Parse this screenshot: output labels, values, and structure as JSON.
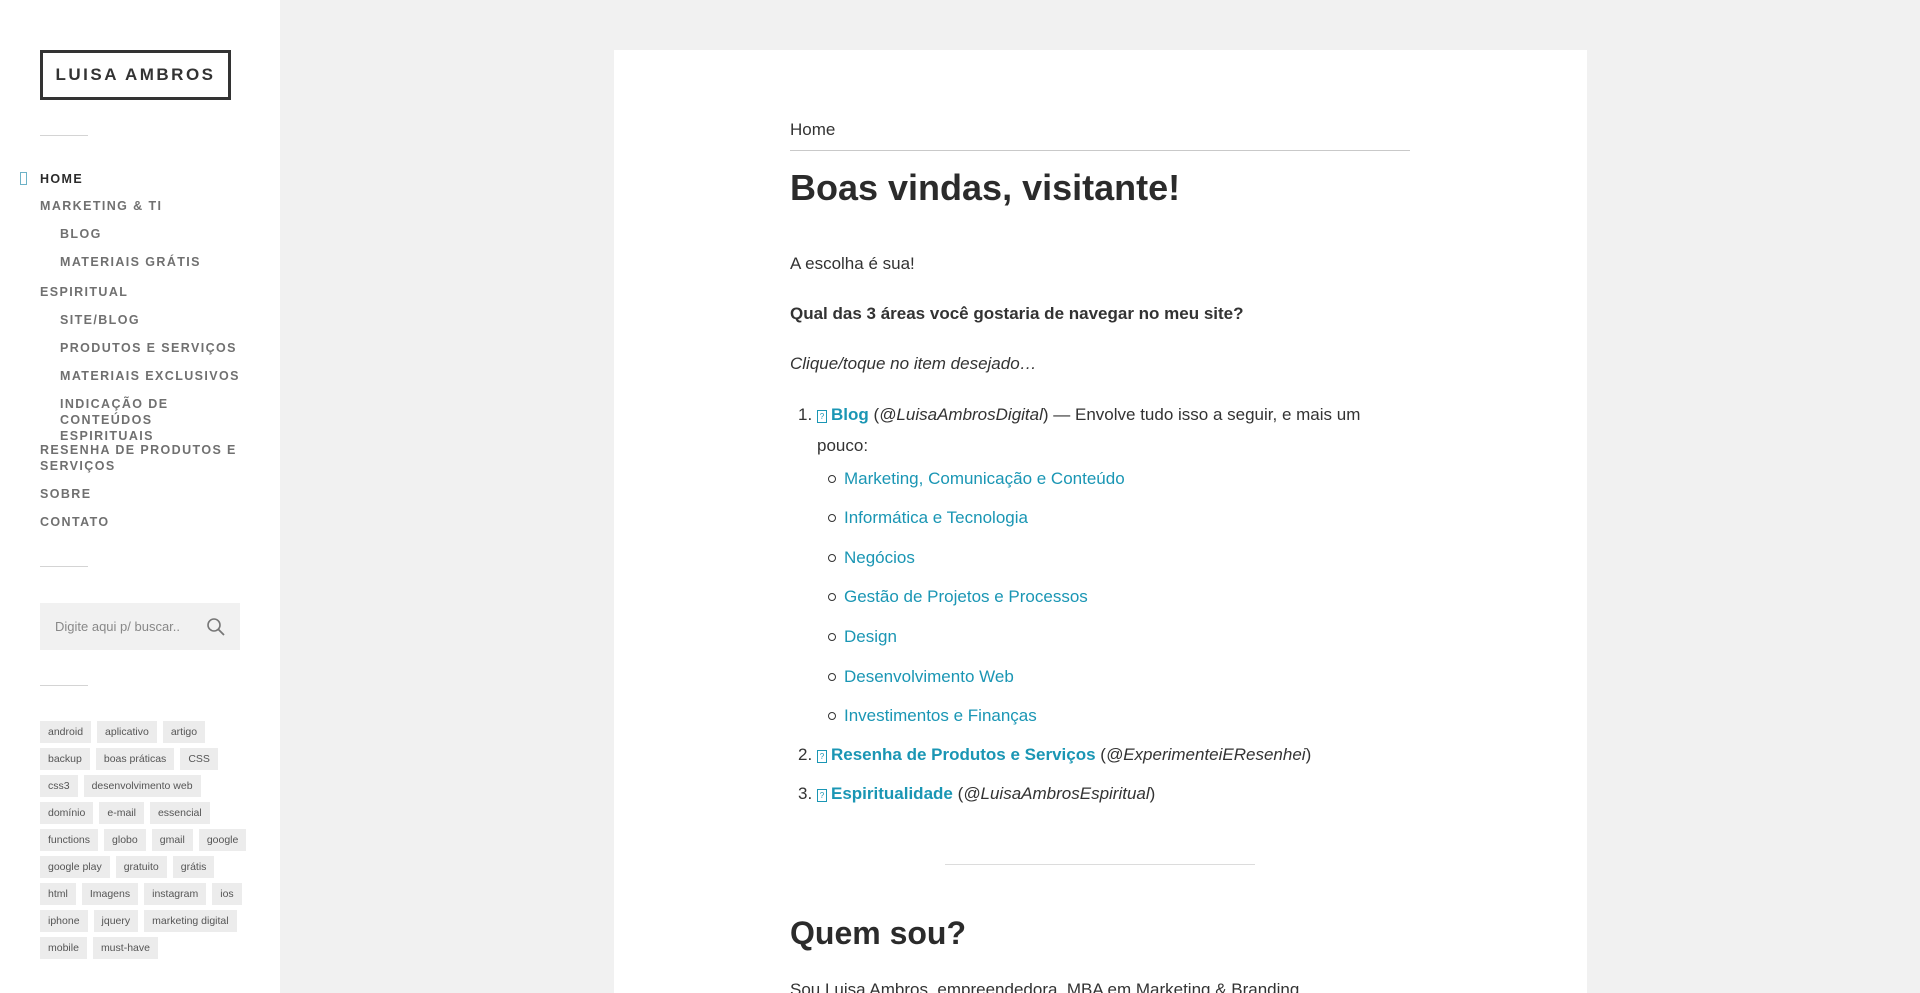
{
  "site": {
    "title": "LUISA AMBROS"
  },
  "nav": {
    "items": [
      {
        "label": "HOME",
        "active": true,
        "sub": false
      },
      {
        "label": "MARKETING & TI",
        "sub": false
      },
      {
        "label": "BLOG",
        "sub": true
      },
      {
        "label": "MATERIAIS GRÁTIS",
        "sub": true
      },
      {
        "label": "ESPIRITUAL",
        "sub": false
      },
      {
        "label": "SITE/BLOG",
        "sub": true
      },
      {
        "label": "PRODUTOS E SERVIÇOS",
        "sub": true
      },
      {
        "label": "MATERIAIS EXCLUSIVOS",
        "sub": true
      },
      {
        "label": "INDICAÇÃO DE CONTEÚDOS ESPIRITUAIS",
        "sub": true
      },
      {
        "label": "RESENHA DE PRODUTOS E SERVIÇOS",
        "sub": false
      },
      {
        "label": "SOBRE",
        "sub": false
      },
      {
        "label": "CONTATO",
        "sub": false
      }
    ]
  },
  "search": {
    "placeholder": "Digite aqui p/ buscar..",
    "icon": "search-icon"
  },
  "tags": [
    "android",
    "aplicativo",
    "artigo",
    "backup",
    "boas práticas",
    "CSS",
    "css3",
    "desenvolvimento web",
    "domínio",
    "e-mail",
    "essencial",
    "functions",
    "globo",
    "gmail",
    "google",
    "google play",
    "gratuito",
    "grátis",
    "html",
    "Imagens",
    "instagram",
    "ios",
    "iphone",
    "jquery",
    "marketing digital",
    "mobile",
    "must-have"
  ],
  "main": {
    "breadcrumb": "Home",
    "title": "Boas vindas, visitante!",
    "p1": "A escolha é sua!",
    "p2": "Qual das 3 áreas você gostaria de navegar no meu site?",
    "p3": "Clique/toque no item desejado…",
    "glyph": "?",
    "list": [
      {
        "num": "1.",
        "link": "Blog",
        "handle": "@LuisaAmbrosDigital",
        "desc": ") — Envolve tudo isso a seguir, e mais um pouco:"
      },
      {
        "num": "2.",
        "link": "Resenha de Produtos e Serviços",
        "handle": "@ExperimenteiEResenhei",
        "desc": ")"
      },
      {
        "num": "3.",
        "link": "Espiritualidade",
        "handle": "@LuisaAmbrosEspiritual",
        "desc": ")"
      }
    ],
    "sublist": [
      "Marketing, Comunicação e Conteúdo",
      "Informática e Tecnologia",
      "Negócios",
      "Gestão de Projetos e Processos",
      "Design",
      "Desenvolvimento Web",
      "Investimentos e Finanças"
    ],
    "section_title": "Quem sou?",
    "intro": "Sou Luisa Ambros, empreendedora, MBA em Marketing & Branding"
  },
  "colors": {
    "link": "#1a96b4",
    "text": "#333333",
    "background": "#f1f1f1"
  }
}
